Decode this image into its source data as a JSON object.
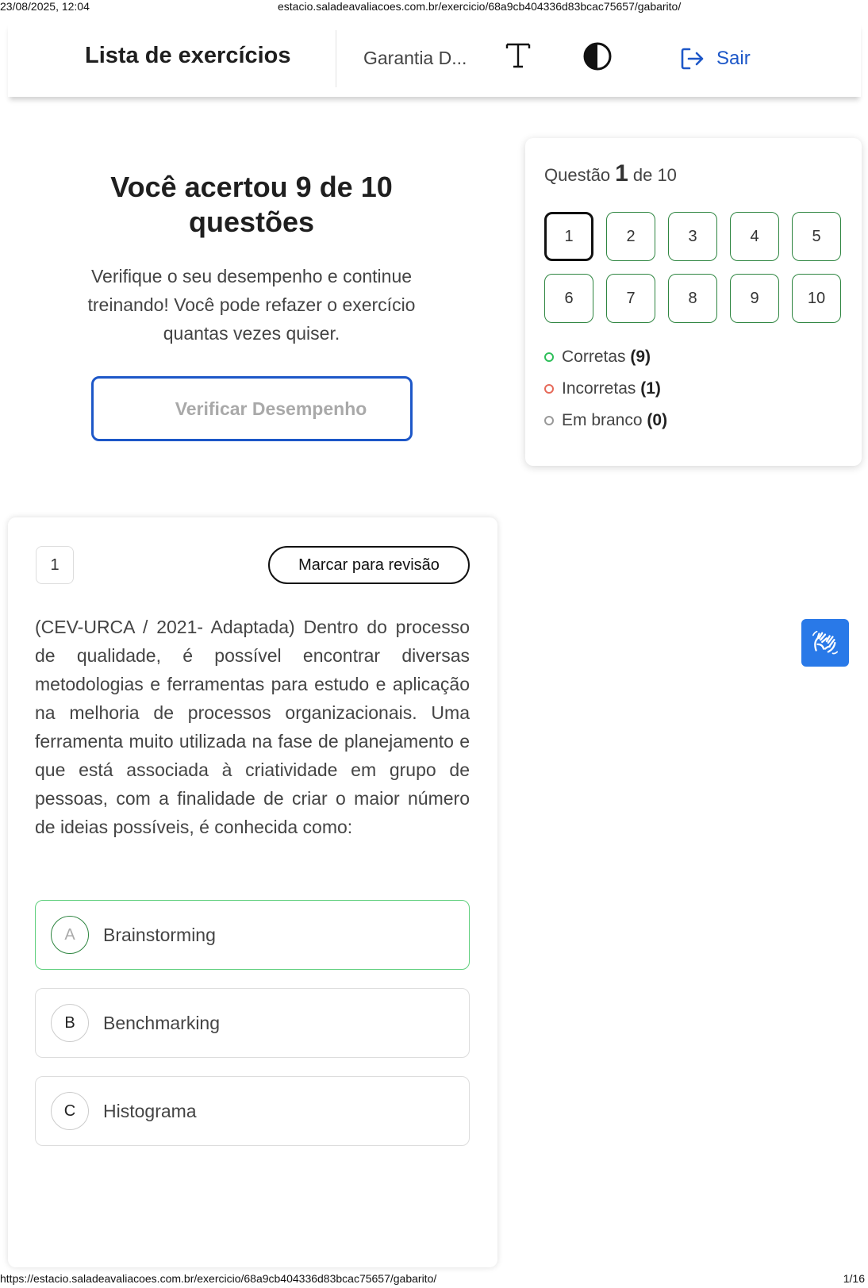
{
  "print": {
    "datetime": "23/08/2025, 12:04",
    "url_top": "estacio.saladeavaliacoes.com.br/exercicio/68a9cb404336d83bcac75657/gabarito/",
    "url_bottom": "https://estacio.saladeavaliacoes.com.br/exercicio/68a9cb404336d83bcac75657/gabarito/",
    "page": "1/16"
  },
  "header": {
    "title": "Lista de exercícios",
    "course": "Garantia D...",
    "logout_label": "Sair",
    "accent_color": "#1d57c8"
  },
  "result": {
    "title": "Você acertou 9 de 10 questões",
    "subtitle": "Verifique o seu desempenho e continue treinando! Você pode refazer o exercício quantas vezes quiser.",
    "button_label": "Verificar Desempenho"
  },
  "navigator": {
    "label_prefix": "Questão",
    "current": "1",
    "label_suffix": "de 10",
    "questions": [
      "1",
      "2",
      "3",
      "4",
      "5",
      "6",
      "7",
      "8",
      "9",
      "10"
    ],
    "legend": {
      "correct_label": "Corretas",
      "correct_count": "(9)",
      "incorrect_label": "Incorretas",
      "incorrect_count": "(1)",
      "blank_label": "Em branco",
      "blank_count": "(0)",
      "correct_color": "#2fbf5a",
      "incorrect_color": "#e66a5a",
      "blank_color": "#999999"
    }
  },
  "question": {
    "number": "1",
    "review_label": "Marcar para revisão",
    "text": "(CEV-URCA / 2021- Adaptada) Dentro do processo de qualidade, é possível encontrar diversas metodologias e ferramentas para estudo e aplicação na melhoria de processos organizacionais. Uma ferramenta muito utilizada na fase de planejamento e que está associada à criatividade em grupo de pessoas, com a finalidade de criar o maior número de ideias possíveis, é conhecida como:",
    "options": [
      {
        "letter": "A",
        "text": "Brainstorming",
        "state": "correct"
      },
      {
        "letter": "B",
        "text": "Benchmarking",
        "state": "default"
      },
      {
        "letter": "C",
        "text": "Histograma",
        "state": "default"
      }
    ]
  },
  "icons": {
    "text_size": "text-size-icon",
    "contrast": "contrast-icon",
    "logout": "logout-icon",
    "libras": "sign-language-icon"
  }
}
